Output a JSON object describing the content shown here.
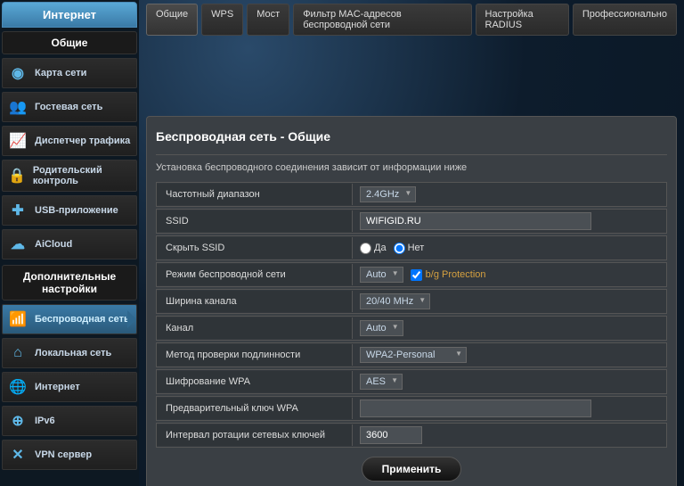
{
  "sidebar": {
    "top": "Интернет",
    "section_general": "Общие",
    "section_adv": "Дополнительные настройки",
    "general_items": [
      {
        "label": "Карта сети",
        "icon": "◉"
      },
      {
        "label": "Гостевая сеть",
        "icon": "👥"
      },
      {
        "label": "Диспетчер трафика",
        "icon": "📈"
      },
      {
        "label": "Родительский контроль",
        "icon": "🔒"
      },
      {
        "label": "USB-приложение",
        "icon": "✚"
      },
      {
        "label": "AiCloud",
        "icon": "☁"
      }
    ],
    "adv_items": [
      {
        "label": "Беспроводная сеть",
        "icon": "📶",
        "active": true
      },
      {
        "label": "Локальная сеть",
        "icon": "⌂"
      },
      {
        "label": "Интернет",
        "icon": "🌐"
      },
      {
        "label": "IPv6",
        "icon": "⊕"
      },
      {
        "label": "VPN сервер",
        "icon": "✕"
      }
    ]
  },
  "tabs": [
    {
      "label": "Общие",
      "active": true
    },
    {
      "label": "WPS"
    },
    {
      "label": "Мост"
    },
    {
      "label": "Фильтр MAC-адресов беспроводной сети"
    },
    {
      "label": "Настройка RADIUS"
    },
    {
      "label": "Профессионально"
    }
  ],
  "panel": {
    "title": "Беспроводная сеть - Общие",
    "desc": "Установка беспроводного соединения зависит от информации ниже",
    "fields": {
      "band_label": "Частотный диапазон",
      "band_val": "2.4GHz",
      "ssid_label": "SSID",
      "ssid_val": "WIFIGID.RU",
      "hide_label": "Скрыть SSID",
      "hide_yes": "Да",
      "hide_no": "Нет",
      "mode_label": "Режим беспроводной сети",
      "mode_val": "Auto",
      "bg_prot": "b/g Protection",
      "width_label": "Ширина канала",
      "width_val": "20/40 MHz",
      "chan_label": "Канал",
      "chan_val": "Auto",
      "auth_label": "Метод проверки подлинности",
      "auth_val": "WPA2-Personal",
      "enc_label": "Шифрование WPA",
      "enc_val": "AES",
      "psk_label": "Предварительный ключ WPA",
      "psk_val": "",
      "rekey_label": "Интервал ротации сетевых ключей",
      "rekey_val": "3600",
      "apply": "Применить"
    }
  }
}
